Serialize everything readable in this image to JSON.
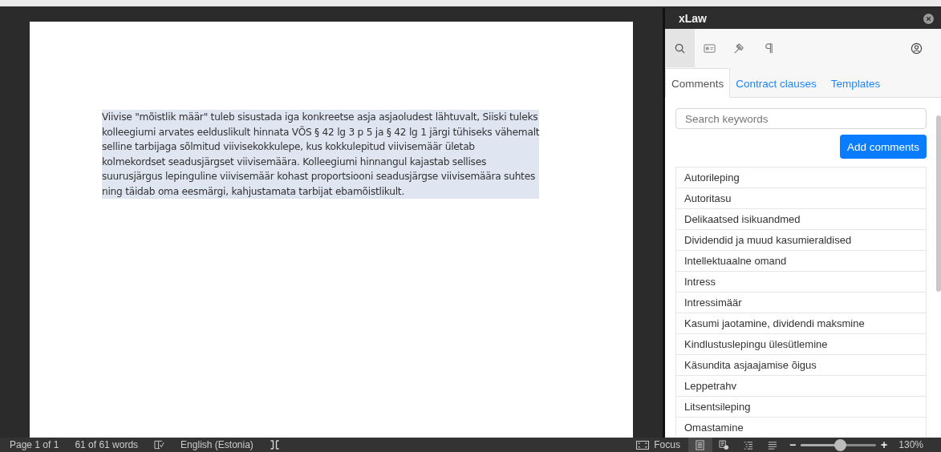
{
  "document": {
    "paragraph": "Viivise \"mõistlik määr\" tuleb sisustada iga konkreetse asja asjaoludest lähtuvalt, Siiski tuleks\nkolleegiumi arvates eelduslikult hinnata VÕS § 42 lg 3 p 5 ja § 42 lg 1 järgi tühiseks vähemalt\nselline tarbijaga sõlmitud viivisekokkulepe, kus kokkulepitud viivisemäär ületab\nkolmekordset seadusjärgset viivisemäära. Kolleegiumi hinnangul kajastab sellises\nsuurusjärgus lepinguline viivisemäär kohast proportsiooni seadusjärgse viivisemäära suhtes\nning täidab oma eesmärgi, kahjustamata tarbijat ebamõistlikult.",
    "selected": true
  },
  "panel": {
    "title": "xLaw",
    "toolbar": [
      {
        "kind": "search",
        "selected": true
      },
      {
        "kind": "card",
        "selected": false
      },
      {
        "kind": "gavel",
        "selected": false
      },
      {
        "kind": "pilcrow",
        "selected": false
      },
      {
        "kind": "user",
        "selected": false
      }
    ],
    "tabs": [
      {
        "label": "Comments",
        "selected": true
      },
      {
        "label": "Contract clauses",
        "selected": false
      },
      {
        "label": "Templates",
        "selected": false
      }
    ],
    "search": {
      "placeholder": "Search keywords"
    },
    "add_button": "Add comments",
    "items": [
      "Autorileping",
      "Autoritasu",
      "Delikaatsed isikuandmed",
      "Dividendid ja muud kasumieraldised",
      "Intellektuaalne omand",
      "Intress",
      "Intressimäär",
      "Kasumi jaotamine, dividendi maksmine",
      "Kindlustuslepingu ülesütlemine",
      "Käsundita asjaajamise õigus",
      "Leppetrahv",
      "Litsentsileping",
      "Omastamine"
    ]
  },
  "status_bar": {
    "page": "Page 1 of 1",
    "words": "61 of 61 words",
    "language": "English (Estonia)",
    "focus": "Focus",
    "views": [
      {
        "kind": "print",
        "selected": true
      },
      {
        "kind": "web",
        "selected": false
      },
      {
        "kind": "outline",
        "selected": false
      },
      {
        "kind": "draft",
        "selected": false
      }
    ],
    "zoom": {
      "minus": "−",
      "plus": "+",
      "level": 0.53,
      "reading": "130%"
    }
  }
}
